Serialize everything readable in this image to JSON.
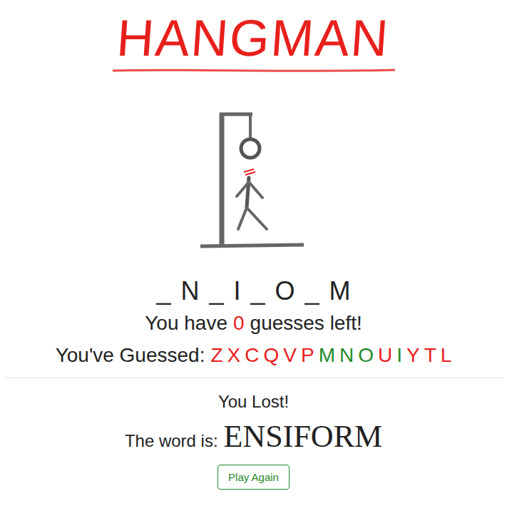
{
  "title": "HANGMAN",
  "figure": {
    "parts": 6
  },
  "word_pattern": [
    "_",
    "N",
    "_",
    "I",
    "_",
    "O",
    "_",
    "M"
  ],
  "guesses_left": {
    "before": "You have",
    "count": "0",
    "after": "guesses left!"
  },
  "guessed": {
    "label": "You've Guessed:",
    "letters": [
      {
        "letter": "Z",
        "color": "#e8201c"
      },
      {
        "letter": "X",
        "color": "#e8201c"
      },
      {
        "letter": "C",
        "color": "#e8201c"
      },
      {
        "letter": "Q",
        "color": "#e8201c"
      },
      {
        "letter": "V",
        "color": "#e8201c"
      },
      {
        "letter": "P",
        "color": "#e8201c"
      },
      {
        "letter": "M",
        "color": "#1f8a2a"
      },
      {
        "letter": "N",
        "color": "#1f8a2a"
      },
      {
        "letter": "O",
        "color": "#1f8a2a"
      },
      {
        "letter": "U",
        "color": "#e8201c"
      },
      {
        "letter": "I",
        "color": "#1f8a2a"
      },
      {
        "letter": "Y",
        "color": "#e8201c"
      },
      {
        "letter": "T",
        "color": "#e8201c"
      },
      {
        "letter": "L",
        "color": "#e8201c"
      }
    ]
  },
  "result": {
    "message": "You Lost!",
    "word_label": "The word is:",
    "word": "ENSIFORM"
  },
  "buttons": [
    "Play Again"
  ]
}
